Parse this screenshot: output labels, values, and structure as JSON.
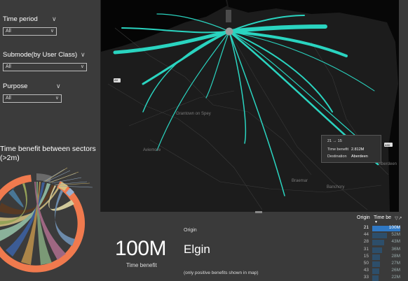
{
  "filters": [
    {
      "label": "Time period",
      "value": "All"
    },
    {
      "label": "Submode(by User Class)",
      "value": "All"
    },
    {
      "label": "Purpose",
      "value": "All"
    }
  ],
  "chord": {
    "title": "Time benefit between sectors (>2m)"
  },
  "map": {
    "places": [
      "Grantown on Spey",
      "Aviemore",
      "Aberdeen",
      "Braemar",
      "Banchory"
    ],
    "road_shields": [
      "A9",
      "A90"
    ]
  },
  "tooltip": {
    "title": "21 → 15",
    "rows": [
      {
        "label": "Time benefit",
        "value": "2.812M"
      },
      {
        "label": "Destination",
        "value": "Aberdeen"
      }
    ]
  },
  "summary": {
    "value": "100M",
    "caption": "Time benefit",
    "origin_label": "Origin",
    "origin_value": "Elgin",
    "note": "(only positive benefits shown in map)"
  },
  "table": {
    "headers": [
      "Origin",
      "Time be"
    ],
    "rows": [
      {
        "origin": "21",
        "value": "100M",
        "fraction": 1.0,
        "selected": true
      },
      {
        "origin": "44",
        "value": "52M",
        "fraction": 0.52
      },
      {
        "origin": "28",
        "value": "43M",
        "fraction": 0.43
      },
      {
        "origin": "31",
        "value": "36M",
        "fraction": 0.36
      },
      {
        "origin": "15",
        "value": "28M",
        "fraction": 0.28
      },
      {
        "origin": "50",
        "value": "27M",
        "fraction": 0.27
      },
      {
        "origin": "43",
        "value": "26M",
        "fraction": 0.26
      },
      {
        "origin": "33",
        "value": "22M",
        "fraction": 0.22
      }
    ]
  },
  "colors": {
    "accent": "#2ad4c0",
    "selected_bar": "#2f78c4",
    "ring": "#f07a4e"
  }
}
